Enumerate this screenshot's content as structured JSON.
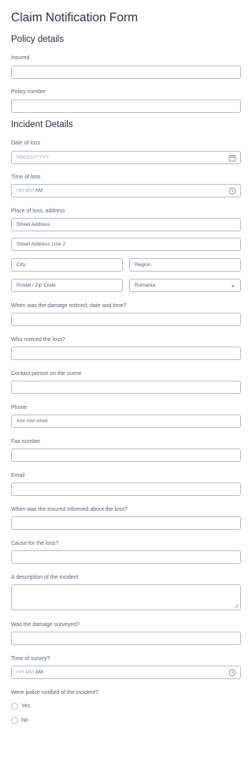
{
  "form": {
    "title": "Claim Notification Form",
    "policy_section": "Policy details",
    "incident_section": "Incident Details",
    "insured": {
      "label": "Insured",
      "value": ""
    },
    "policy_number": {
      "label": "Policy number",
      "value": ""
    },
    "date_of_loss": {
      "label": "Date of loss",
      "placeholder": "MM/DD/YYYY",
      "icon": "calendar-icon"
    },
    "time_of_loss": {
      "label": "Time of loss",
      "placeholder": "HH:MM",
      "ampm": "AM",
      "icon": "clock-icon"
    },
    "place_of_loss": {
      "label": "Place of loss, address",
      "street1": "Street Address",
      "street2": "Street Address Line 2",
      "city": "City",
      "region": "Region",
      "postal": "Postal / Zip Code",
      "country": "Romania"
    },
    "damage_noticed": {
      "label": "When was the damage noticed; date and time?"
    },
    "who_noticed": {
      "label": "Who noticed the loss?"
    },
    "contact_person": {
      "label": "Contact person on the scene"
    },
    "phone": {
      "label": "Phone",
      "placeholder": "### ### ####"
    },
    "fax": {
      "label": "Fax number"
    },
    "email": {
      "label": "Email"
    },
    "insured_informed": {
      "label": "When was the insured informed about the loss?"
    },
    "cause": {
      "label": "Cause for the loss?"
    },
    "description": {
      "label": "A description of the incident"
    },
    "surveyed": {
      "label": "Was the damage surveyed?"
    },
    "time_of_survey": {
      "label": "Time of survey?",
      "placeholder": "HH:MM",
      "ampm": "AM",
      "icon": "clock-icon"
    },
    "police": {
      "label": "Were police notified of the incident?",
      "options": [
        "Yes",
        "No"
      ]
    }
  },
  "colors": {
    "border": "#b8bdc9",
    "text": "#57647e",
    "heading": "#2c3345",
    "placeholder": "#a8b0c0"
  }
}
